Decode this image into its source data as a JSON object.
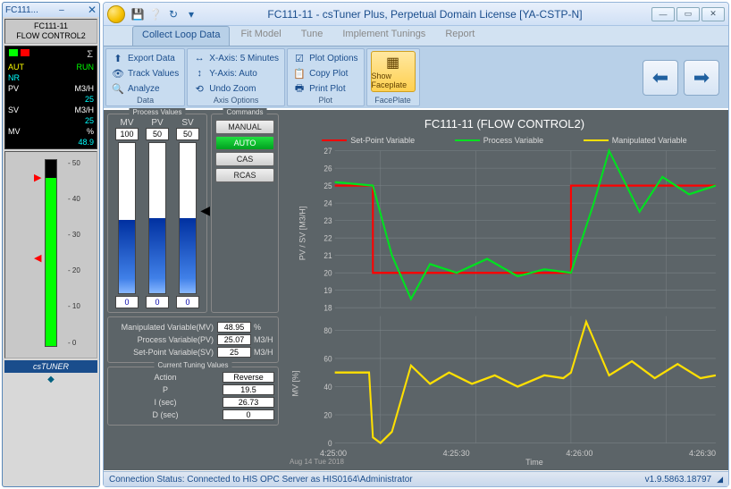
{
  "window": {
    "title": "FC111-11 - csTuner Plus, Perpetual Domain License [YA-CSTP-N]",
    "faceplate_title": "FC111..."
  },
  "ribbon": {
    "tabs": [
      "Collect Loop Data",
      "Fit Model",
      "Tune",
      "Implement Tunings",
      "Report"
    ],
    "active_tab": 0,
    "groups": {
      "data": {
        "label": "Data",
        "items": [
          "Export Data",
          "Track Values",
          "Analyze"
        ]
      },
      "axis": {
        "label": "Axis Options",
        "items": [
          "X-Axis: 5 Minutes",
          "Y-Axis: Auto",
          "Undo Zoom"
        ]
      },
      "plot": {
        "label": "Plot",
        "items": [
          "Plot Options",
          "Copy Plot",
          "Print Plot"
        ]
      },
      "faceplate": {
        "label": "FacePlate",
        "button": "Show Faceplate"
      }
    }
  },
  "commands": {
    "label": "Commands",
    "buttons": [
      "MANUAL",
      "AUTO",
      "CAS",
      "RCAS"
    ],
    "active": 1
  },
  "process_values": {
    "label": "Process Values",
    "bars": [
      {
        "name": "MV",
        "top": "100",
        "bot": "0",
        "fill_pct": 49
      },
      {
        "name": "PV",
        "top": "50",
        "bot": "0",
        "fill_pct": 50
      },
      {
        "name": "SV",
        "top": "50",
        "bot": "0",
        "fill_pct": 50
      }
    ],
    "rows": [
      {
        "label": "Manipulated Variable(MV)",
        "value": "48.95",
        "unit": "%"
      },
      {
        "label": "Process Variable(PV)",
        "value": "25.07",
        "unit": "M3/H"
      },
      {
        "label": "Set-Point Variable(SV)",
        "value": "25",
        "unit": "M3/H"
      }
    ]
  },
  "tuning": {
    "label": "Current Tuning Values",
    "rows": [
      {
        "label": "Action",
        "value": "Reverse"
      },
      {
        "label": "P",
        "value": "19.5"
      },
      {
        "label": "I (sec)",
        "value": "26.73"
      },
      {
        "label": "D (sec)",
        "value": "0"
      }
    ]
  },
  "chart": {
    "title": "FC111-11 (FLOW CONTROL2)",
    "legend": [
      {
        "name": "Set-Point Variable",
        "color": "#ff0000"
      },
      {
        "name": "Process Variable",
        "color": "#00e020"
      },
      {
        "name": "Manipulated Variable",
        "color": "#ffe000"
      }
    ],
    "top_ylabel": "PV / SV [M3/H]",
    "bot_ylabel": "MV [%]",
    "xlabel": "Time",
    "date_label": "Aug 14 Tue 2018",
    "time_ticks": [
      "4:25:00",
      "4:25:30",
      "4:26:00",
      "4:26:30"
    ],
    "top_yticks": [
      "27",
      "26",
      "25",
      "24",
      "23",
      "22",
      "21",
      "20",
      "19",
      "18"
    ],
    "bot_yticks": [
      "80",
      "60",
      "40",
      "20",
      "0"
    ]
  },
  "chart_data": {
    "type": "line",
    "x_range": [
      "4:24:45",
      "4:26:45"
    ],
    "top": {
      "ylabel": "PV / SV [M3/H]",
      "ylim": [
        18,
        27
      ],
      "series": [
        {
          "name": "Set-Point Variable",
          "color": "#ff0000",
          "values": [
            [
              0,
              25
            ],
            [
              10,
              25
            ],
            [
              10,
              20
            ],
            [
              62,
              20
            ],
            [
              62,
              25
            ],
            [
              100,
              25
            ]
          ]
        },
        {
          "name": "Process Variable",
          "color": "#00e020",
          "values": [
            [
              0,
              25.2
            ],
            [
              10,
              25
            ],
            [
              15,
              21
            ],
            [
              20,
              18.5
            ],
            [
              25,
              20.5
            ],
            [
              32,
              20
            ],
            [
              40,
              20.8
            ],
            [
              48,
              19.8
            ],
            [
              55,
              20.2
            ],
            [
              62,
              20
            ],
            [
              68,
              24
            ],
            [
              72,
              27
            ],
            [
              80,
              23.5
            ],
            [
              86,
              25.5
            ],
            [
              93,
              24.5
            ],
            [
              100,
              25
            ]
          ]
        }
      ]
    },
    "bottom": {
      "ylabel": "MV [%]",
      "ylim": [
        0,
        90
      ],
      "series": [
        {
          "name": "Manipulated Variable",
          "color": "#ffe000",
          "values": [
            [
              0,
              50
            ],
            [
              9,
              50
            ],
            [
              10,
              4
            ],
            [
              12,
              0
            ],
            [
              15,
              8
            ],
            [
              20,
              55
            ],
            [
              25,
              42
            ],
            [
              30,
              50
            ],
            [
              36,
              42
            ],
            [
              42,
              48
            ],
            [
              48,
              40
            ],
            [
              55,
              48
            ],
            [
              60,
              46
            ],
            [
              62,
              50
            ],
            [
              66,
              86
            ],
            [
              72,
              48
            ],
            [
              78,
              58
            ],
            [
              84,
              46
            ],
            [
              90,
              56
            ],
            [
              96,
              46
            ],
            [
              100,
              48
            ]
          ]
        }
      ]
    }
  },
  "faceplate": {
    "tag": "FC111-11",
    "desc": "FLOW CONTROL2",
    "mode_left": "AUT",
    "mode_right": "RUN",
    "alarm": "NR",
    "rows": [
      {
        "l": "PV",
        "ru": "M3/H",
        "v": "25"
      },
      {
        "l": "SV",
        "ru": "M3/H",
        "v": "25"
      },
      {
        "l": "MV",
        "ru": "%",
        "v": "48.9"
      }
    ],
    "scale": [
      "50",
      "40",
      "30",
      "20",
      "10",
      "0"
    ],
    "bar_fill_pct": 90,
    "footer": "csTUNER"
  },
  "statusbar": {
    "text": "Connection Status: Connected to HIS OPC Server as HIS0164\\Administrator",
    "version": "v1.9.5863.18797"
  }
}
